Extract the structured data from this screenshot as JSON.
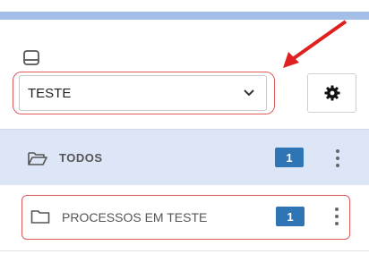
{
  "mailbox_selector": {
    "value": "TESTE"
  },
  "folders": [
    {
      "label": "TODOS",
      "count": "1"
    },
    {
      "label": "PROCESSOS EM TESTE",
      "count": "1"
    }
  ],
  "colors": {
    "top_bar": "#a3bfe8",
    "highlight": "#e05a5a",
    "count_badge": "#2f74b5",
    "selected_row": "#dde6f7"
  },
  "icons": [
    "inbox-icon",
    "chevron-down-icon",
    "gear-icon",
    "folder-open-icon",
    "folder-icon",
    "kebab-menu-icon",
    "red-arrow-annotation"
  ]
}
